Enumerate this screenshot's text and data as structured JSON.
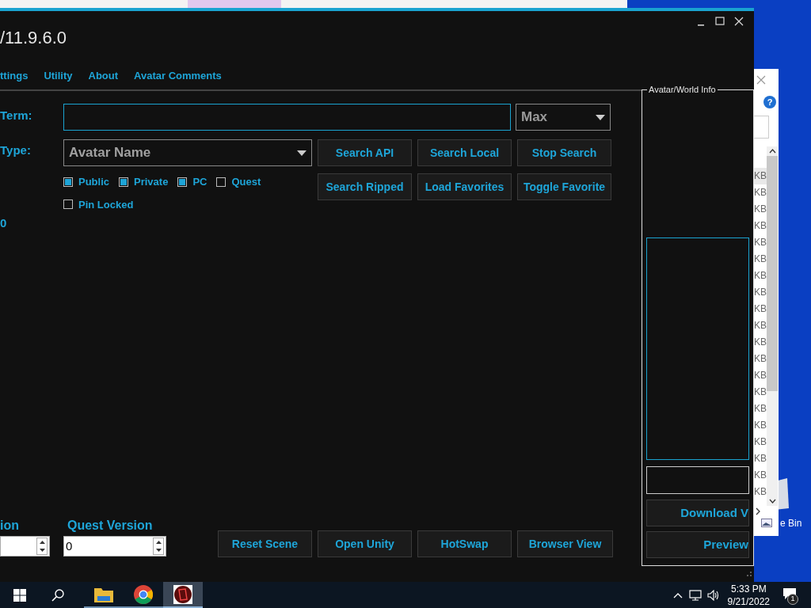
{
  "window": {
    "title": "/11.9.6.0"
  },
  "tabs": [
    {
      "label": "ttings"
    },
    {
      "label": "Utility"
    },
    {
      "label": "About"
    },
    {
      "label": "Avatar Comments"
    }
  ],
  "search": {
    "term_label": "Term:",
    "limit": "Max",
    "type_label": "Type:",
    "type": "Avatar Name"
  },
  "filters": [
    {
      "label": "Public",
      "checked": true
    },
    {
      "label": "Private",
      "checked": true
    },
    {
      "label": "PC",
      "checked": true
    },
    {
      "label": "Quest",
      "checked": false
    },
    {
      "label": "Pin Locked",
      "checked": false
    }
  ],
  "search_buttons": [
    "Search API",
    "Search Local",
    "Stop Search",
    "Search Ripped",
    "Load Favorites",
    "Toggle Favorite"
  ],
  "result_count": "0",
  "versions": [
    {
      "label": "ion"
    },
    {
      "label": "Quest Version",
      "value": "0"
    }
  ],
  "bottom_buttons": [
    "Reset Scene",
    "Open Unity",
    "HotSwap",
    "Browser View"
  ],
  "info_panel": {
    "title": "Avatar/World Info",
    "buttons": [
      "Download V",
      "Preview"
    ]
  },
  "side_window": {
    "help": "?",
    "rows": [
      "KB",
      "KB",
      "KB",
      "KB",
      "KB",
      "KB",
      "KB",
      "KB",
      "KB",
      "KB",
      "KB",
      "KB",
      "KB",
      "KB",
      "KB",
      "KB",
      "KB",
      "KB",
      "KB",
      "KB"
    ]
  },
  "desktop": {
    "recycle_bin_label": "e Bin"
  },
  "taskbar": {
    "apps": [
      {
        "kind": "folder",
        "active": false
      },
      {
        "kind": "browser",
        "active": false
      },
      {
        "kind": "app",
        "active": true
      }
    ],
    "time": "5:33 PM",
    "date": "9/21/2022",
    "notifications": "1"
  }
}
